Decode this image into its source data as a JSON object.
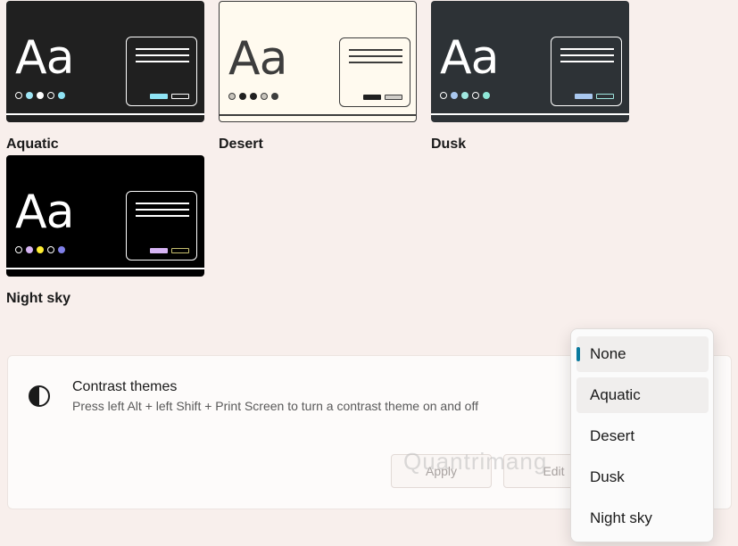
{
  "themes": [
    {
      "name": "Aquatic",
      "preview_text": "Aa",
      "bg": "#202020",
      "fg": "#ffffff",
      "line": "#ffffff",
      "dots": [
        "#202020",
        "#9fe6f5",
        "#ffffff",
        "#202020",
        "#8fe4f5"
      ],
      "dot_border": "#ffffff",
      "btn1": "#8fe4f5",
      "btn2_border": "#ffffff"
    },
    {
      "name": "Desert",
      "preview_text": "Aa",
      "bg": "#fffaef",
      "fg": "#3d3d3d",
      "line": "#3d3d3d",
      "dots": [
        "#c8c4bc",
        "#202020",
        "#202020",
        "#c8c4bc",
        "#3d3d3d"
      ],
      "dot_border": "#3d3d3d",
      "btn1": "#202020",
      "btn2_border": "#3d3d3d"
    },
    {
      "name": "Dusk",
      "preview_text": "Aa",
      "bg": "#2d3236",
      "fg": "#ffffff",
      "line": "#ffffff",
      "dots": [
        "#2d3236",
        "#a9c8f0",
        "#a0e8e0",
        "#2d3236",
        "#8ee8d8"
      ],
      "dot_border": "#ffffff",
      "btn1": "#a9c8f0",
      "btn2_border": "#a0e8e0"
    },
    {
      "name": "Night sky",
      "preview_text": "Aa",
      "bg": "#000000",
      "fg": "#ffffff",
      "line": "#ffffff",
      "dots": [
        "#000000",
        "#d6b4f4",
        "#ffee32",
        "#000000",
        "#8080e8"
      ],
      "dot_border": "#ffffff",
      "btn1": "#d6b4f4",
      "btn2_border": "#c8c070"
    }
  ],
  "contrast": {
    "title": "Contrast themes",
    "subtitle": "Press left Alt + left Shift + Print Screen to turn a contrast theme on and off",
    "apply_label": "Apply",
    "edit_label": "Edit"
  },
  "watermark": "Quantrimang",
  "dropdown": {
    "selected": "None",
    "options": [
      "None",
      "Aquatic",
      "Desert",
      "Dusk",
      "Night sky"
    ]
  },
  "colors": {
    "accent": "#0a7a9e",
    "page_bg": "#f8efec"
  }
}
